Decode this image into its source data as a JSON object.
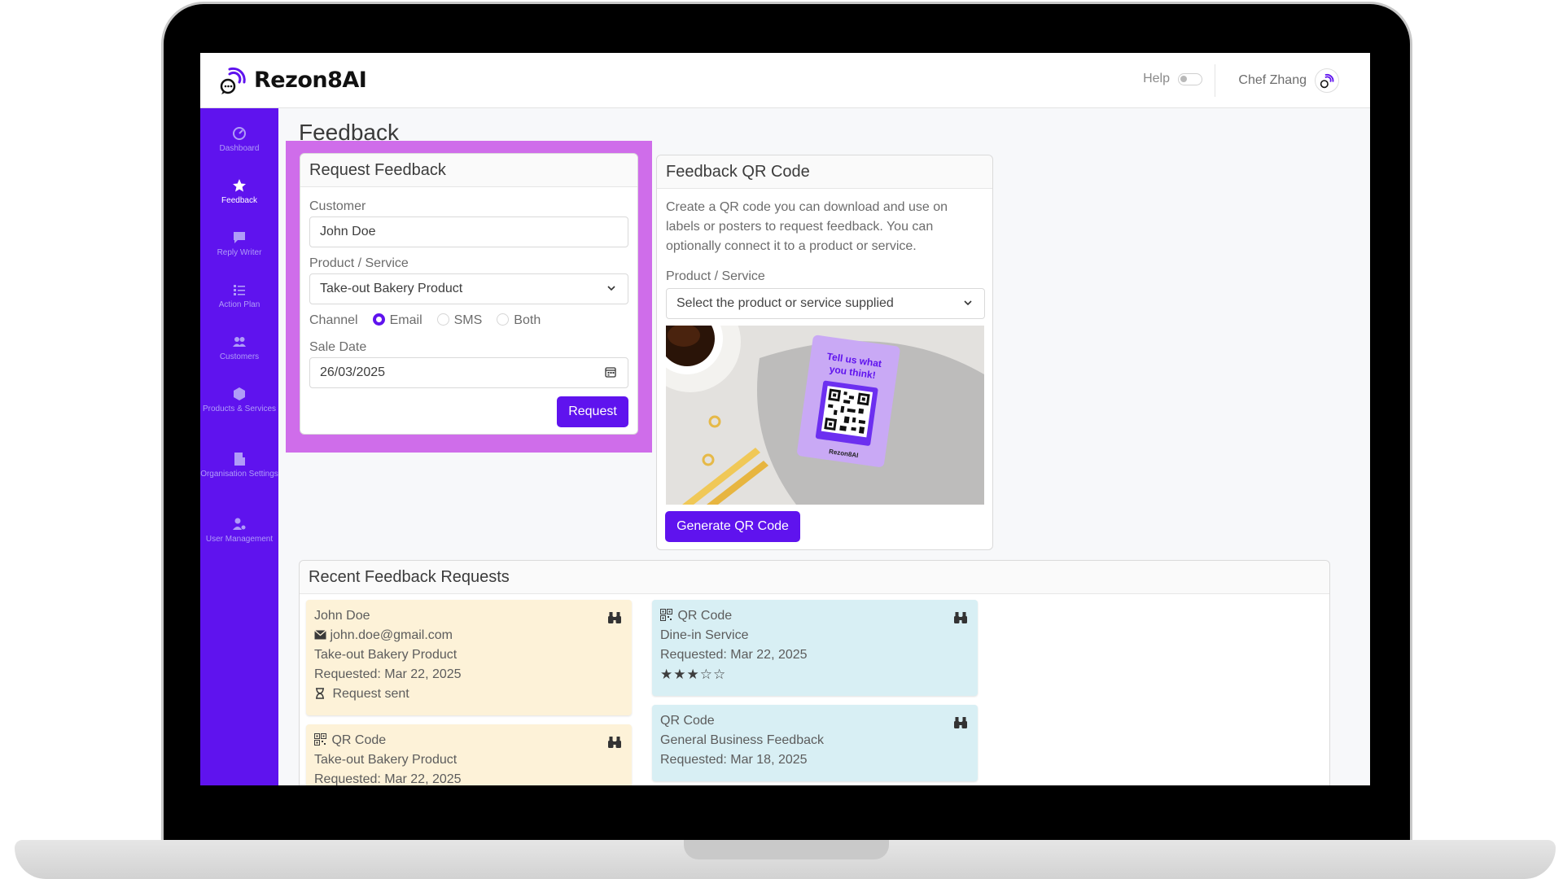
{
  "app": {
    "name": "Rezon8AI"
  },
  "header": {
    "help_label": "Help",
    "user_name": "Chef Zhang"
  },
  "sidebar": {
    "items": [
      {
        "label": "Dashboard",
        "icon": "dashboard-icon"
      },
      {
        "label": "Feedback",
        "icon": "star-icon",
        "active": true
      },
      {
        "label": "Reply Writer",
        "icon": "chat-icon"
      },
      {
        "label": "Action Plan",
        "icon": "list-icon"
      },
      {
        "label": "Customers",
        "icon": "users-icon"
      },
      {
        "label": "Products & Services",
        "icon": "box-icon"
      },
      {
        "label": "Organisation Settings",
        "icon": "building-icon"
      },
      {
        "label": "User Management",
        "icon": "user-gear-icon"
      }
    ]
  },
  "page": {
    "title": "Feedback"
  },
  "request_feedback": {
    "title": "Request Feedback",
    "customer_label": "Customer",
    "customer_value": "John Doe",
    "product_label": "Product / Service",
    "product_value": "Take-out Bakery Product",
    "channel_label": "Channel",
    "channel_options": [
      "Email",
      "SMS",
      "Both"
    ],
    "channel_selected": "Email",
    "sale_date_label": "Sale Date",
    "sale_date_value": "26/03/2025",
    "request_button": "Request"
  },
  "qr_code": {
    "title": "Feedback QR Code",
    "description": "Create a QR code you can download and use on labels or posters to request feedback. You can optionally connect it to a product or service.",
    "product_label": "Product / Service",
    "product_placeholder": "Select the product or service supplied",
    "sticker_text": "Tell us what you think!",
    "sticker_brand": "Rezon8AI",
    "generate_button": "Generate QR Code"
  },
  "recent": {
    "title": "Recent Feedback Requests",
    "cards": [
      {
        "name": "John Doe",
        "email": "john.doe@gmail.com",
        "product": "Take-out Bakery Product",
        "requested": "Requested: Mar 22, 2025",
        "status": "Request sent"
      },
      {
        "type": "QR Code",
        "product": "Dine-in Service",
        "requested": "Requested: Mar 22, 2025",
        "rating": 3,
        "rating_max": 5,
        "stars_text": "★★★☆☆"
      },
      {
        "type": "QR Code",
        "product": "Take-out Bakery Product",
        "requested": "Requested: Mar 22, 2025"
      },
      {
        "type": "QR Code",
        "product": "General Business Feedback",
        "requested": "Requested: Mar 18, 2025"
      }
    ]
  },
  "colors": {
    "brand": "#5f13ee",
    "highlight": "#cf6dea",
    "yellow_card": "#fdf2d8",
    "blue_card": "#d8eff4"
  }
}
